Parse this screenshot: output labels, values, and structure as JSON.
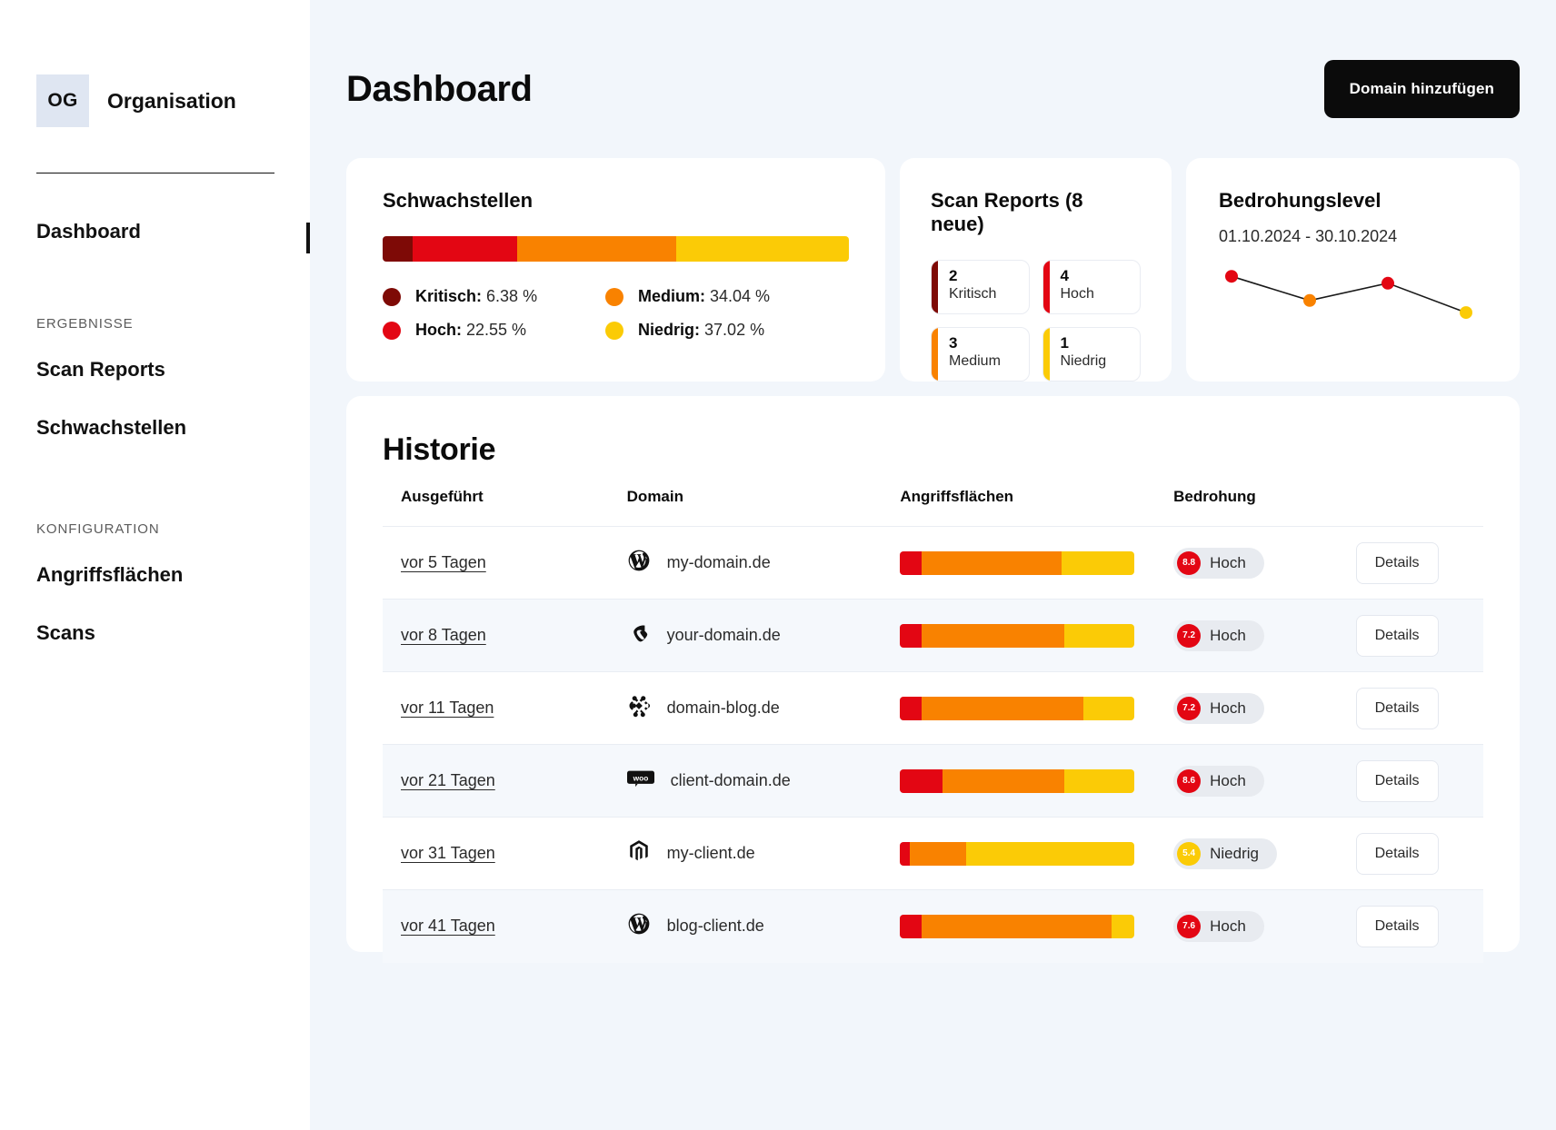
{
  "colors": {
    "kritisch": "#7e0a06",
    "hoch": "#e30613",
    "medium": "#f98200",
    "niedrig": "#fbcb06",
    "accent_dark": "#0b0b0b",
    "bg": "#f2f6fb"
  },
  "sidebar": {
    "org_initials": "OG",
    "org_name": "Organisation",
    "primary": [
      {
        "label": "Dashboard",
        "name": "sidebar-item-dashboard",
        "active": true
      }
    ],
    "groups": [
      {
        "label": "ERGEBNISSE",
        "items": [
          {
            "label": "Scan Reports",
            "name": "sidebar-item-scan-reports"
          },
          {
            "label": "Schwachstellen",
            "name": "sidebar-item-schwachstellen"
          }
        ]
      },
      {
        "label": "KONFIGURATION",
        "items": [
          {
            "label": "Angriffsflächen",
            "name": "sidebar-item-angriffsflaechen"
          },
          {
            "label": "Scans",
            "name": "sidebar-item-scans"
          }
        ]
      }
    ]
  },
  "header": {
    "title": "Dashboard",
    "add_domain_label": "Domain hinzufügen"
  },
  "vulnerabilities": {
    "title": "Schwachstellen",
    "legend": [
      {
        "label": "Kritisch:",
        "value": "6.38 %",
        "color": "#7e0a06",
        "pct": 6.38
      },
      {
        "label": "Medium:",
        "value": "34.04 %",
        "color": "#f98200",
        "pct": 34.04
      },
      {
        "label": "Hoch:",
        "value": "22.55 %",
        "color": "#e30613",
        "pct": 22.55
      },
      {
        "label": "Niedrig:",
        "value": "37.02 %",
        "color": "#fbcb06",
        "pct": 37.02
      }
    ],
    "bar_order": [
      {
        "color": "#7e0a06",
        "pct": 6.38
      },
      {
        "color": "#e30613",
        "pct": 22.55
      },
      {
        "color": "#f98200",
        "pct": 34.04
      },
      {
        "color": "#fbcb06",
        "pct": 37.02
      }
    ]
  },
  "scan_reports": {
    "title_main": "Scan Reports",
    "title_suffix": " (8 neue)",
    "chips": [
      {
        "count": "2",
        "label": "Kritisch",
        "color": "#7e0a06"
      },
      {
        "count": "4",
        "label": "Hoch",
        "color": "#e30613"
      },
      {
        "count": "3",
        "label": "Medium",
        "color": "#f98200"
      },
      {
        "count": "1",
        "label": "Niedrig",
        "color": "#fbcb06"
      }
    ]
  },
  "threat_level": {
    "title": "Bedrohungslevel",
    "date_range": "01.10.2024 - 30.10.2024"
  },
  "chart_data": {
    "type": "line",
    "title": "Bedrohungslevel",
    "subtitle": "01.10.2024 - 30.10.2024",
    "xlabel": "",
    "ylabel": "",
    "grid": false,
    "legend": "none",
    "x": [
      0,
      1,
      2,
      3
    ],
    "points": [
      {
        "x": 0,
        "y": 8.4,
        "color": "#e30613",
        "level": "Hoch"
      },
      {
        "x": 1,
        "y": 5.6,
        "color": "#f98200",
        "level": "Medium"
      },
      {
        "x": 2,
        "y": 7.6,
        "color": "#e30613",
        "level": "Hoch"
      },
      {
        "x": 3,
        "y": 4.2,
        "color": "#fbcb06",
        "level": "Niedrig"
      }
    ],
    "ylim": [
      0,
      10
    ]
  },
  "history": {
    "title": "Historie",
    "columns": [
      "Ausgeführt",
      "Domain",
      "Angriffsflächen",
      "Bedrohung",
      ""
    ],
    "details_label": "Details",
    "rows": [
      {
        "run": "vor 5 Tagen",
        "domain": "my-domain.de",
        "cms": "wordpress-icon",
        "surface": [
          {
            "color": "#e30613",
            "pct": 9
          },
          {
            "color": "#f98200",
            "pct": 60
          },
          {
            "color": "#fbcb06",
            "pct": 31
          }
        ],
        "score": "8.8",
        "score_color": "#e30613",
        "threat": "Hoch"
      },
      {
        "run": "vor 8 Tagen",
        "domain": "your-domain.de",
        "cms": "typo3-icon",
        "surface": [
          {
            "color": "#e30613",
            "pct": 9
          },
          {
            "color": "#f98200",
            "pct": 61
          },
          {
            "color": "#fbcb06",
            "pct": 30
          }
        ],
        "score": "7.2",
        "score_color": "#e30613",
        "threat": "Hoch"
      },
      {
        "run": "vor 11 Tagen",
        "domain": "domain-blog.de",
        "cms": "joomla-icon",
        "surface": [
          {
            "color": "#e30613",
            "pct": 9
          },
          {
            "color": "#f98200",
            "pct": 69
          },
          {
            "color": "#fbcb06",
            "pct": 22
          }
        ],
        "score": "7.2",
        "score_color": "#e30613",
        "threat": "Hoch"
      },
      {
        "run": "vor 21 Tagen",
        "domain": "client-domain.de",
        "cms": "woocommerce-icon",
        "surface": [
          {
            "color": "#e30613",
            "pct": 18
          },
          {
            "color": "#f98200",
            "pct": 52
          },
          {
            "color": "#fbcb06",
            "pct": 30
          }
        ],
        "score": "8.6",
        "score_color": "#e30613",
        "threat": "Hoch"
      },
      {
        "run": "vor 31 Tagen",
        "domain": "my-client.de",
        "cms": "magento-icon",
        "surface": [
          {
            "color": "#e30613",
            "pct": 4
          },
          {
            "color": "#f98200",
            "pct": 24
          },
          {
            "color": "#fbcb06",
            "pct": 72
          }
        ],
        "score": "5.4",
        "score_color": "#fbcb06",
        "threat": "Niedrig"
      },
      {
        "run": "vor 41 Tagen",
        "domain": "blog-client.de",
        "cms": "wordpress-icon",
        "surface": [
          {
            "color": "#e30613",
            "pct": 9
          },
          {
            "color": "#f98200",
            "pct": 81
          },
          {
            "color": "#fbcb06",
            "pct": 10
          }
        ],
        "score": "7.6",
        "score_color": "#e30613",
        "threat": "Hoch"
      }
    ]
  }
}
